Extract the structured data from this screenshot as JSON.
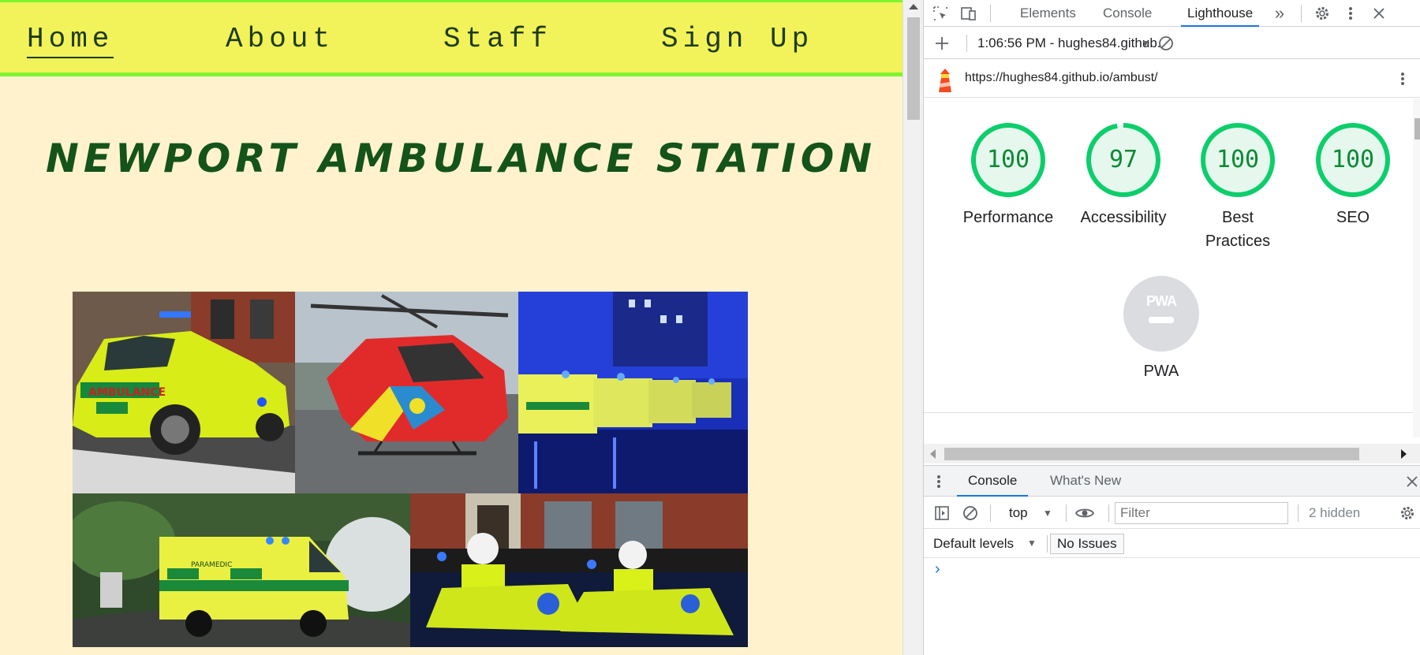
{
  "site": {
    "nav": [
      {
        "label": "Home",
        "active": true
      },
      {
        "label": "About",
        "active": false
      },
      {
        "label": "Staff",
        "active": false
      },
      {
        "label": "Sign Up",
        "active": false
      }
    ],
    "title": "NEWPORT AMBULANCE STATION",
    "colors": {
      "nav_bg": "#f2f25a",
      "nav_border": "#7ff52e",
      "page_bg": "#fff2cc",
      "title": "#14531a"
    }
  },
  "devtools": {
    "tabs": [
      "Elements",
      "Console",
      "Lighthouse"
    ],
    "active_tab": "Lighthouse",
    "more_tabs_icon": "chevron-double-right-icon",
    "report_selector": "1:06:56 PM - hughes84.github.",
    "url": "https://hughes84.github.io/ambust/",
    "scores": [
      {
        "label": "Performance",
        "value": 100
      },
      {
        "label": "Accessibility",
        "value": 97
      },
      {
        "label": "Best Practices",
        "value": 100
      },
      {
        "label": "SEO",
        "value": 100
      }
    ],
    "pwa": {
      "badge": "PWA",
      "label": "PWA"
    },
    "drawer": {
      "tabs": [
        "Console",
        "What's New"
      ],
      "active_tab": "Console",
      "context": "top",
      "filter_placeholder": "Filter",
      "hidden_count": "2 hidden",
      "levels": "Default levels",
      "issues": "No Issues",
      "prompt": "›"
    },
    "colors": {
      "score_pass": "#0cce6b",
      "score_text": "#0b8a34",
      "accent": "#1a73e8",
      "pwa_grey": "#dadce0"
    }
  }
}
